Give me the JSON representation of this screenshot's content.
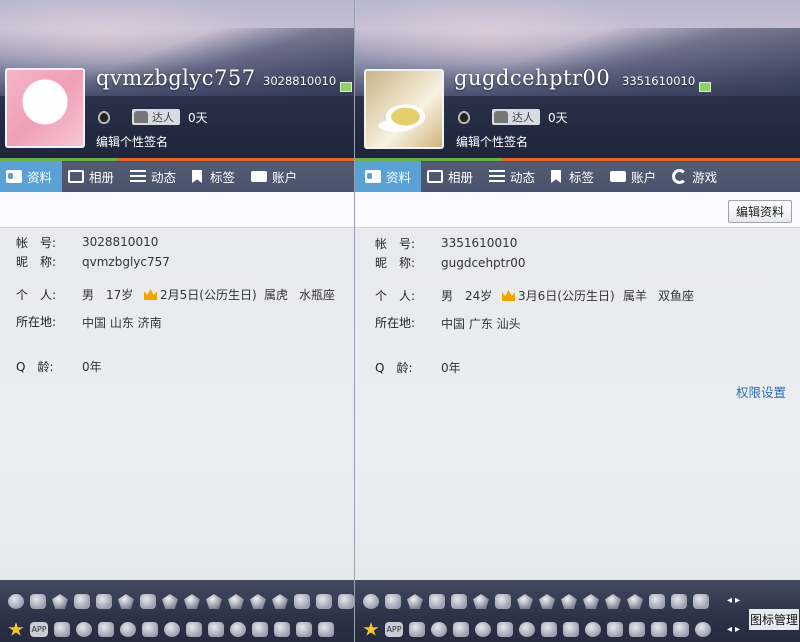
{
  "left": {
    "username": "qvmzbglyc757",
    "qq_number": "3028810010",
    "daren_label": "达人",
    "days": "0天",
    "signature": "编辑个性签名",
    "tabs": [
      "资料",
      "相册",
      "动态",
      "标签",
      "账户"
    ],
    "fields": {
      "account_label": "帐　号:",
      "account_value": "3028810010",
      "nickname_label": "昵　称:",
      "nickname_value": "qvmzbglyc757",
      "personal_label": "个　人:",
      "gender": "男",
      "age": "17岁",
      "birthday": "2月5日(公历生日)",
      "zodiac": "属虎",
      "constellation": "水瓶座",
      "location_label": "所在地:",
      "location_value": "中国 山东 济南",
      "qage_label": "Q　龄:",
      "qage_value": "0年"
    }
  },
  "right": {
    "username": "gugdcehptr00",
    "qq_number": "3351610010",
    "daren_label": "达人",
    "days": "0天",
    "signature": "编辑个性签名",
    "tabs": [
      "资料",
      "相册",
      "动态",
      "标签",
      "账户",
      "游戏"
    ],
    "edit_button": "编辑资料",
    "permission_link": "权限设置",
    "tray_manage": "图标管理",
    "fields": {
      "account_label": "帐　号:",
      "account_value": "3351610010",
      "nickname_label": "昵　称:",
      "nickname_value": "gugdcehptr00",
      "personal_label": "个　人:",
      "gender": "男",
      "age": "24岁",
      "birthday": "3月6日(公历生日)",
      "zodiac": "属羊",
      "constellation": "双鱼座",
      "location_label": "所在地:",
      "location_value": "中国 广东 汕头",
      "qage_label": "Q　龄:",
      "qage_value": "0年"
    }
  },
  "tray_app_label": "APP",
  "colors": {
    "active_tab": "#5aa2d6",
    "link": "#2b6fb6",
    "accent_line": "#e3672a"
  }
}
